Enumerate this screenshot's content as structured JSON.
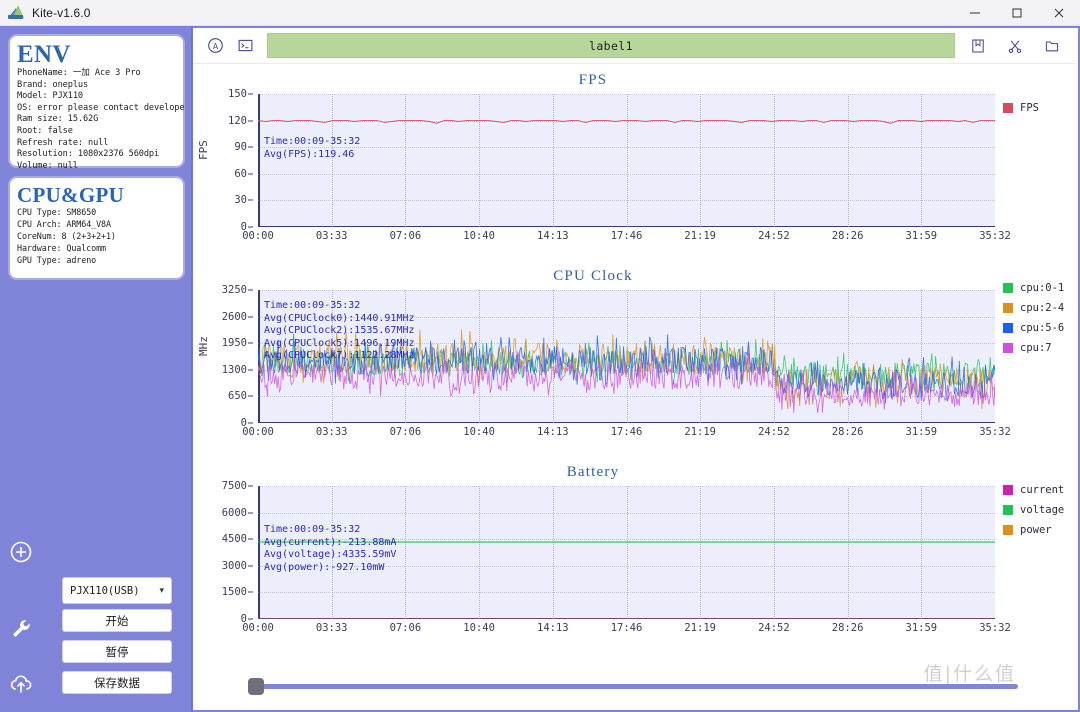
{
  "window": {
    "title": "Kite-v1.6.0",
    "icon": "kite-icon",
    "controls": {
      "minimize": "minimize-icon",
      "maximize": "maximize-icon",
      "close": "close-icon"
    }
  },
  "sidebar": {
    "env_card": {
      "title": "ENV",
      "lines": "PhoneName: 一加 Ace 3 Pro\nBrand: oneplus\nModel: PJX110\nOS: error please contact develope\nRam size: 15.62G\nRoot: false\nRefresh rate: null\nResolution: 1080x2376 560dpi\nVolume: null"
    },
    "cpu_card": {
      "title": "CPU&GPU",
      "lines": "CPU Type: SM8650\nCPU Arch: ARM64_V8A\nCoreNum: 8 (2+3+2+1)\nHardware: Qualcomm\nGPU Type: adreno"
    },
    "rail": [
      {
        "name": "add-icon"
      },
      {
        "name": "wrench-icon"
      },
      {
        "name": "upload-cloud-icon"
      }
    ],
    "device_select": {
      "value": "PJX110(USB)",
      "caret": "chevron-down-icon"
    },
    "buttons": [
      {
        "label": "开始"
      },
      {
        "label": "暂停"
      },
      {
        "label": "保存数据"
      }
    ]
  },
  "toolbar": {
    "left_icons": [
      "gauge-icon",
      "terminal-icon"
    ],
    "label": "label1",
    "right_icons": [
      "bookmark-save-icon",
      "scissors-icon",
      "folder-open-icon"
    ]
  },
  "slider": {
    "position_percent": 0
  },
  "watermark": "值|什么值",
  "chart_data": [
    {
      "id": "fps",
      "type": "line",
      "title": "FPS",
      "ylabel": "FPS",
      "xlabel": "",
      "ylim": [
        0,
        150
      ],
      "yticks": [
        0,
        30,
        60,
        90,
        120,
        150
      ],
      "xticks": [
        "00:00",
        "03:33",
        "07:06",
        "10:40",
        "14:13",
        "17:46",
        "21:19",
        "24:52",
        "28:26",
        "31:59",
        "35:32"
      ],
      "grid": true,
      "legend_position": "right",
      "annotations": [
        "Time:00:09-35:32",
        "Avg(FPS):119.46"
      ],
      "series": [
        {
          "name": "FPS",
          "color": "#d94a5e",
          "mean": 119.46,
          "values": [
            120,
            119,
            120,
            120,
            119,
            120,
            120,
            120,
            119,
            118,
            120,
            120,
            120,
            119,
            120,
            120,
            120,
            118,
            119,
            120,
            120,
            120,
            120,
            119,
            117,
            120,
            120,
            119,
            120,
            120,
            120,
            120,
            119,
            118,
            120,
            120,
            119,
            120,
            120,
            120,
            120,
            119,
            120,
            120,
            118,
            120,
            120,
            120,
            119,
            120,
            120,
            120,
            119,
            120,
            120,
            120,
            118,
            120,
            120,
            119,
            120,
            120,
            120,
            120,
            119,
            118,
            120,
            120,
            120,
            119,
            120,
            120,
            120,
            119,
            120,
            120,
            118,
            120,
            120,
            120,
            119,
            120,
            120,
            120,
            119,
            117,
            120,
            120,
            120,
            119,
            120,
            120,
            120,
            120,
            119,
            120,
            118,
            120,
            120,
            120
          ]
        }
      ]
    },
    {
      "id": "cpu-clock",
      "type": "line",
      "title": "CPU Clock",
      "ylabel": "MHz",
      "xlabel": "",
      "ylim": [
        0,
        3250
      ],
      "yticks": [
        0,
        650,
        1300,
        1950,
        2600,
        3250
      ],
      "xticks": [
        "00:00",
        "03:33",
        "07:06",
        "10:40",
        "14:13",
        "17:46",
        "21:19",
        "24:52",
        "28:26",
        "31:59",
        "35:32"
      ],
      "grid": true,
      "legend_position": "right",
      "annotations": [
        "Time:00:09-35:32",
        "Avg(CPUClock0):1440.91MHz",
        "Avg(CPUClock2):1535.67MHz",
        "Avg(CPUClock5):1496.19MHz",
        "Avg(CPUClock7):1122.28MHz"
      ],
      "series": [
        {
          "name": "cpu:0-1",
          "color": "#22c355",
          "mean": 1440.91
        },
        {
          "name": "cpu:2-4",
          "color": "#d9901c",
          "mean": 1535.67
        },
        {
          "name": "cpu:5-6",
          "color": "#1d5ff0",
          "mean": 1496.19
        },
        {
          "name": "cpu:7",
          "color": "#d24fe0",
          "mean": 1122.28
        }
      ]
    },
    {
      "id": "battery",
      "type": "line",
      "title": "Battery",
      "ylabel": "",
      "xlabel": "",
      "ylim": [
        0,
        7500
      ],
      "yticks": [
        0,
        1500,
        3000,
        4500,
        6000,
        7500
      ],
      "xticks": [
        "00:00",
        "03:33",
        "07:06",
        "10:40",
        "14:13",
        "17:46",
        "21:19",
        "24:52",
        "28:26",
        "31:59",
        "35:32"
      ],
      "grid": true,
      "legend_position": "right",
      "annotations": [
        "Time:00:09-35:32",
        "Avg(current):-213.88mA",
        "Avg(voltage):4335.59mV",
        "Avg(power):-927.10mW"
      ],
      "series": [
        {
          "name": "current",
          "color": "#cc22b4",
          "mean": -213.88
        },
        {
          "name": "voltage",
          "color": "#22c355",
          "mean": 4335.59
        },
        {
          "name": "power",
          "color": "#d9901c",
          "mean": -927.1
        }
      ]
    }
  ]
}
